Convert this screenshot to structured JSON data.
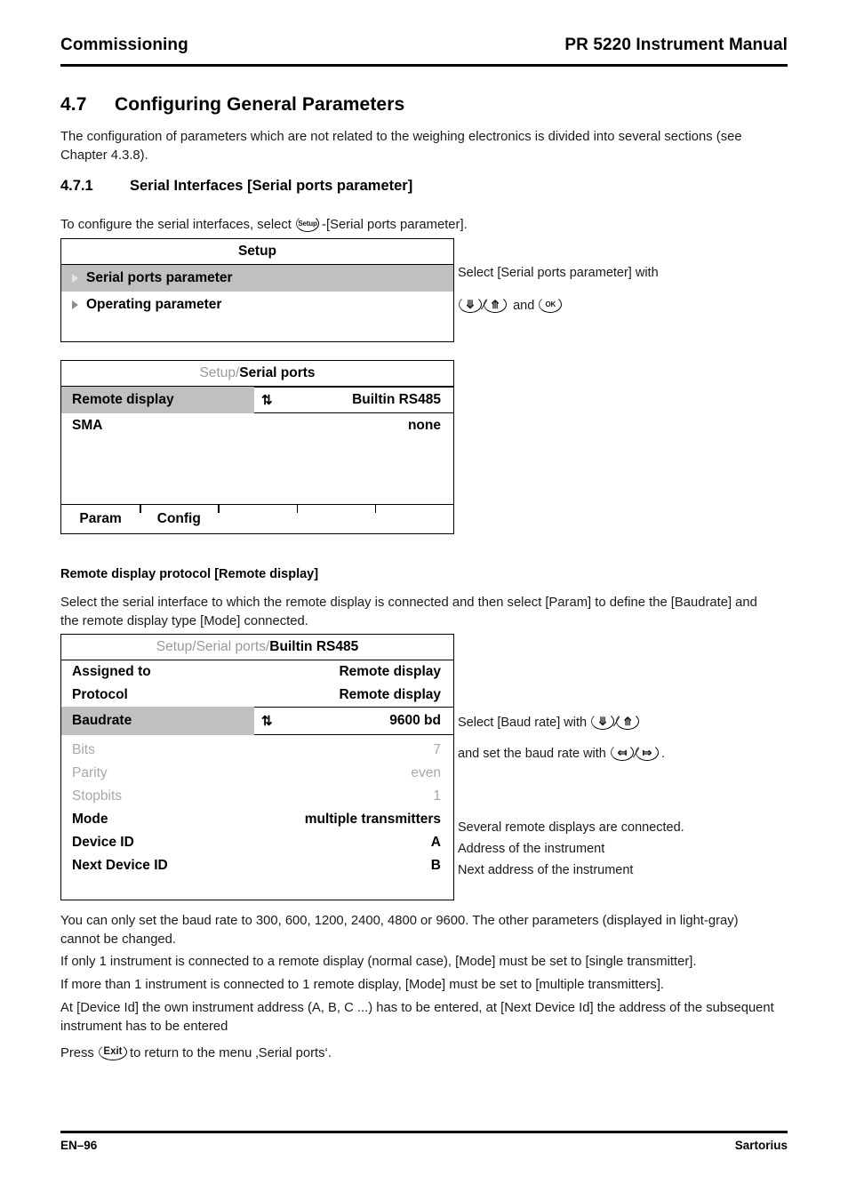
{
  "header": {
    "left": "Commissioning",
    "right": "PR 5220 Instrument Manual"
  },
  "section": {
    "number": "4.7",
    "title": "Configuring General Parameters",
    "intro": "The configuration of parameters which are not related to the weighing electronics is divided into several sections (see Chapter 4.3.8)."
  },
  "subsection": {
    "number": "4.7.1",
    "title": "Serial Interfaces [Serial ports parameter]",
    "lead_before": "To configure the serial interfaces, select",
    "lead_icon": "Setup",
    "lead_after": "-[Serial ports parameter]."
  },
  "setup_panel": {
    "title": "Setup",
    "items": [
      {
        "label": "Serial ports parameter",
        "selected": true
      },
      {
        "label": "Operating parameter",
        "selected": false
      }
    ]
  },
  "setup_anno": {
    "line1": "Select [Serial ports parameter] with",
    "key_down": "down-arrow",
    "key_up": "up-arrow",
    "and": "and",
    "key_ok": "OK"
  },
  "serial_ports_panel": {
    "title_dim": "Setup/",
    "title_bold": "Serial ports",
    "rows": [
      {
        "label": "Remote display",
        "value": "Builtin  RS485",
        "selected": true,
        "updown": true
      },
      {
        "label": "SMA",
        "value": "none",
        "selected": false,
        "updown": false
      }
    ],
    "softkeys": [
      "Param",
      "Config",
      "",
      "",
      ""
    ]
  },
  "remote_display": {
    "heading": "Remote display protocol [Remote display]",
    "body": "Select the serial interface to which the remote display is connected and then select [Param] to define the [Baudrate] and the remote display type [Mode] connected."
  },
  "builtin_panel": {
    "title_dim": "Setup/Serial ports/",
    "title_bold": "Builtin  RS485",
    "rows": [
      {
        "label": "Assigned to",
        "value": "Remote display",
        "style": "normal",
        "updown": false
      },
      {
        "label": "Protocol",
        "value": "Remote display",
        "style": "normal",
        "updown": false
      },
      {
        "label": "Baudrate",
        "value": "9600  bd",
        "style": "selected",
        "updown": true
      },
      {
        "label": "Bits",
        "value": "7",
        "style": "dim",
        "updown": false
      },
      {
        "label": "Parity",
        "value": "even",
        "style": "dim",
        "updown": false
      },
      {
        "label": "Stopbits",
        "value": "1",
        "style": "dim",
        "updown": false
      },
      {
        "label": "Mode",
        "value": "multiple transmitters",
        "style": "normal",
        "updown": false
      },
      {
        "label": "Device ID",
        "value": "A",
        "style": "normal",
        "updown": false
      },
      {
        "label": "Next Device ID",
        "value": "B",
        "style": "normal",
        "updown": false
      }
    ]
  },
  "builtin_anno": {
    "baud_select_before": "Select [Baud rate] with",
    "baud_set_before": "and set the baud rate with",
    "baud_set_after": ".",
    "mode_note": "Several remote displays are connected.",
    "device_note": "Address of the instrument",
    "next_device_note": "Next address of the instrument"
  },
  "notes": {
    "baud_rates": "You can only set the baud rate to 300, 600, 1200, 2400, 4800 or 9600. The other parameters (displayed in light-gray) cannot be changed.",
    "single": "If only 1 instrument is connected to a remote display (normal case), [Mode] must be set to [single transmitter].",
    "multiple": "If more than 1 instrument is connected to 1 remote display, [Mode] must be set to [multiple transmitters].",
    "device_id": "At [Device Id] the own instrument address (A, B, C ...) has to be entered, at [Next Device Id] the address of the subsequent instrument has to be entered",
    "press_before": "Press",
    "press_icon": "Exit",
    "press_after": "to return to the menu ‚Serial ports‘."
  },
  "footer": {
    "page": "EN–96",
    "brand": "Sartorius"
  }
}
